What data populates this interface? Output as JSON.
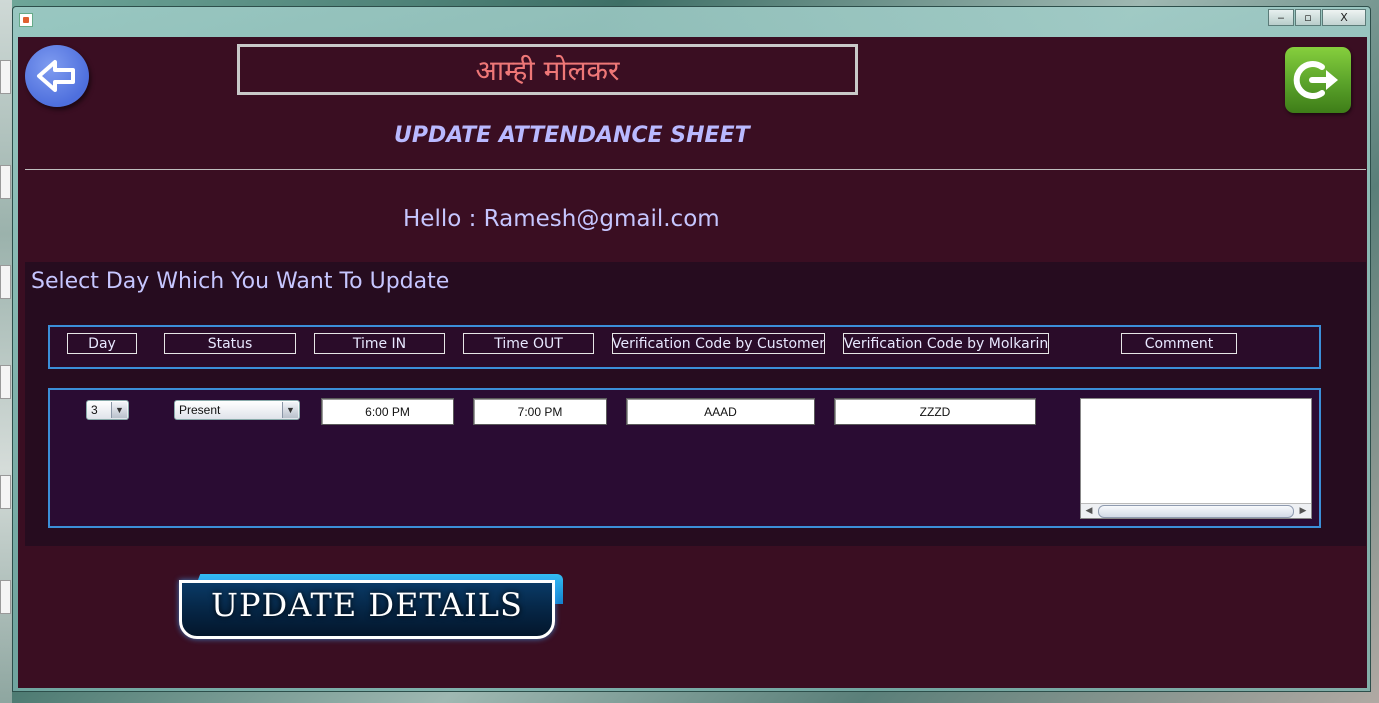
{
  "window": {
    "controls": {
      "minimize": "‒",
      "maximize": "▫",
      "close": "X"
    }
  },
  "header": {
    "brand": "आम्ही मोलकर",
    "page_title": "UPDATE ATTENDANCE SHEET",
    "greeting_prefix": "Hello : ",
    "user_email": "Ramesh@gmail.com"
  },
  "section": {
    "title": "Select Day Which You Want To Update",
    "columns": [
      "Day",
      "Status",
      "Time IN",
      "Time OUT",
      "Verification Code by Customer",
      "Verification Code by Molkarin",
      "Comment"
    ]
  },
  "row": {
    "day": "3",
    "status": "Present",
    "time_in": "6:00 PM",
    "time_out": "7:00 PM",
    "customer_code": "AAAD",
    "molkarin_code": "ZZZD",
    "comment": ""
  },
  "actions": {
    "update_label": "UPDATE DETAILS"
  },
  "icons": {
    "back": "back-arrow-icon",
    "exit": "exit-icon",
    "dropdown": "chevron-down-icon"
  },
  "colors": {
    "background": "#3a0e22",
    "panel_border": "#3b8fd8",
    "title_text": "#b9b9ff",
    "brand_text": "#ee7777",
    "exit_green": "#5aa22a",
    "back_blue": "#4e6fdd"
  }
}
